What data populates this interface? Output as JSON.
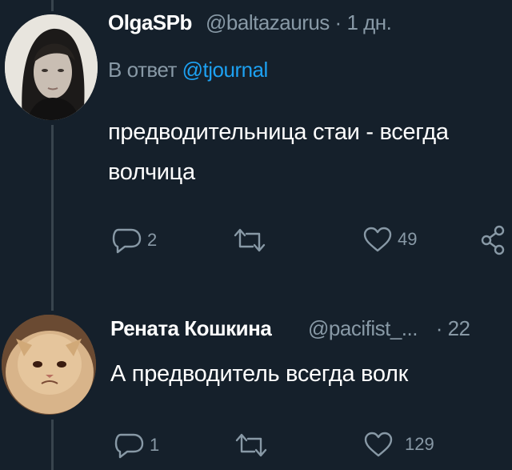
{
  "tweet1": {
    "author_name": "OlgaSPb",
    "handle": "@baltazaurus",
    "separator": "·",
    "time": "1 дн.",
    "reply_prefix": "В ответ",
    "reply_to": "@tjournal",
    "text_line1": "предводительница стаи - всегда",
    "text_line2": "волчица",
    "replies": "2",
    "likes": "49"
  },
  "tweet2": {
    "author_name": "Рената Кошкина",
    "handle": "@pacifist_...",
    "separator": "·",
    "time": "22",
    "text": "А предводитель всегда волк",
    "replies": "1",
    "likes": "129"
  },
  "icons": {
    "reply": "reply-icon",
    "retweet": "retweet-icon",
    "like": "like-icon",
    "share": "share-icon"
  },
  "colors": {
    "background": "#15202b",
    "secondary_text": "#8899a6",
    "link": "#1da1f2"
  }
}
